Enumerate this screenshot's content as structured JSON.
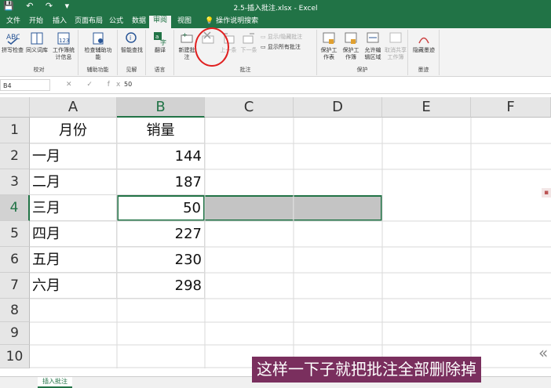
{
  "titlebar": {
    "qat": "💾 ↶ ↷ ▾",
    "title": "2.5-插入批注.xlsx  -  Excel"
  },
  "tabs": [
    "文件",
    "开始",
    "插入",
    "页面布局",
    "公式",
    "数据",
    "审阅",
    "视图",
    "操作说明搜索"
  ],
  "ribbon": {
    "proofing": {
      "spelling": "拼写检查",
      "thesaurus": "同义词库",
      "stats": "工作簿统计信息",
      "label": "校对"
    },
    "accessibility": {
      "check": "检查辅助功能",
      "label": "辅助功能"
    },
    "insights": {
      "smart": "智能查找",
      "label": "见解"
    },
    "language": {
      "translate": "翻译",
      "label": "语言"
    },
    "comments": {
      "new": "新建批注",
      "prev": "上一条",
      "next": "下一条",
      "show_hide": "显示/隐藏批注",
      "show_all": "显示所有批注",
      "label": "批注"
    },
    "protect": {
      "protect_sheet": "保护工作表",
      "protect_book": "保护工作簿",
      "allow_edit": "允许编辑区域",
      "unshare": "取消共享工作簿",
      "label": "保护"
    },
    "ink": {
      "hide_ink": "隐藏墨迹",
      "label": "墨迹"
    }
  },
  "formula": {
    "namebox": "B4",
    "fx": "✕ ✓ fx",
    "value": "50"
  },
  "columns": [
    "A",
    "B",
    "C",
    "D",
    "E",
    "F"
  ],
  "rows": [
    "1",
    "2",
    "3",
    "4",
    "5",
    "6",
    "7",
    "8",
    "9",
    "10"
  ],
  "cells": {
    "a1": "月份",
    "b1": "销量",
    "a2": "一月",
    "b2": "144",
    "a3": "二月",
    "b3": "187",
    "a4": "三月",
    "b4": "50",
    "a5": "四月",
    "b5": "227",
    "a6": "五月",
    "b6": "230",
    "a7": "六月",
    "b7": "298"
  },
  "sheet_tab": "插入批注",
  "subtitle": "这样一下子就把批注全部删除掉",
  "colors": {
    "accent": "#217346",
    "highlight": "#e02020",
    "subtitle_bg": "#7a2f5e"
  }
}
